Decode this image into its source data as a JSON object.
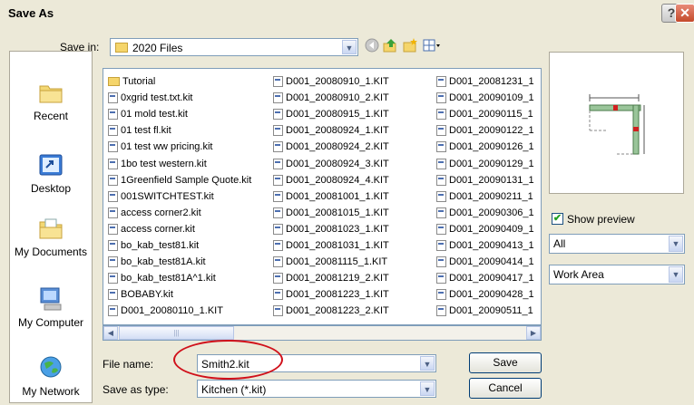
{
  "window": {
    "title": "Save As"
  },
  "toolbar": {
    "save_in_label": "Save in:",
    "save_in_value": "2020 Files",
    "icons": [
      "back-icon",
      "up-folder-icon",
      "new-folder-icon",
      "views-menu-icon"
    ]
  },
  "places": [
    {
      "label": "Recent",
      "icon": "recent-folder-icon"
    },
    {
      "label": "Desktop",
      "icon": "desktop-icon"
    },
    {
      "label": "My Documents",
      "icon": "my-documents-icon"
    },
    {
      "label": "My Computer",
      "icon": "my-computer-icon"
    },
    {
      "label": "My Network",
      "icon": "my-network-icon"
    }
  ],
  "files": {
    "col1": [
      "Tutorial",
      "0xgrid test.txt.kit",
      "01 mold test.kit",
      "01 test fl.kit",
      "01 test ww pricing.kit",
      "1bo test western.kit",
      "1Greenfield Sample Quote.kit",
      "001SWITCHTEST.kit",
      "access corner2.kit",
      "access corner.kit",
      "bo_kab_test81.kit",
      "bo_kab_test81A.kit",
      "bo_kab_test81A^1.kit",
      "BOBABY.kit",
      "D001_20080110_1.KIT"
    ],
    "col2": [
      "D001_20080910_1.KIT",
      "D001_20080910_2.KIT",
      "D001_20080915_1.KIT",
      "D001_20080924_1.KIT",
      "D001_20080924_2.KIT",
      "D001_20080924_3.KIT",
      "D001_20080924_4.KIT",
      "D001_20081001_1.KIT",
      "D001_20081015_1.KIT",
      "D001_20081023_1.KIT",
      "D001_20081031_1.KIT",
      "D001_20081115_1.KIT",
      "D001_20081219_2.KIT",
      "D001_20081223_1.KIT",
      "D001_20081223_2.KIT"
    ],
    "col3": [
      "D001_20081231_1",
      "D001_20090109_1",
      "D001_20090115_1",
      "D001_20090122_1",
      "D001_20090126_1",
      "D001_20090129_1",
      "D001_20090131_1",
      "D001_20090211_1",
      "D001_20090306_1",
      "D001_20090409_1",
      "D001_20090413_1",
      "D001_20090414_1",
      "D001_20090417_1",
      "D001_20090428_1",
      "D001_20090511_1"
    ]
  },
  "side": {
    "show_preview_label": "Show preview",
    "show_preview_checked": true,
    "dropdown1_value": "All",
    "dropdown2_value": "Work Area"
  },
  "footer": {
    "file_name_label": "File name:",
    "file_name_value": "Smith2.kit",
    "save_as_type_label": "Save as type:",
    "save_as_type_value": "Kitchen (*.kit)",
    "save_button": "Save",
    "cancel_button": "Cancel"
  },
  "colors": {
    "annotation_circle": "#d0101a",
    "titlebar_close": "#c44a2b"
  }
}
